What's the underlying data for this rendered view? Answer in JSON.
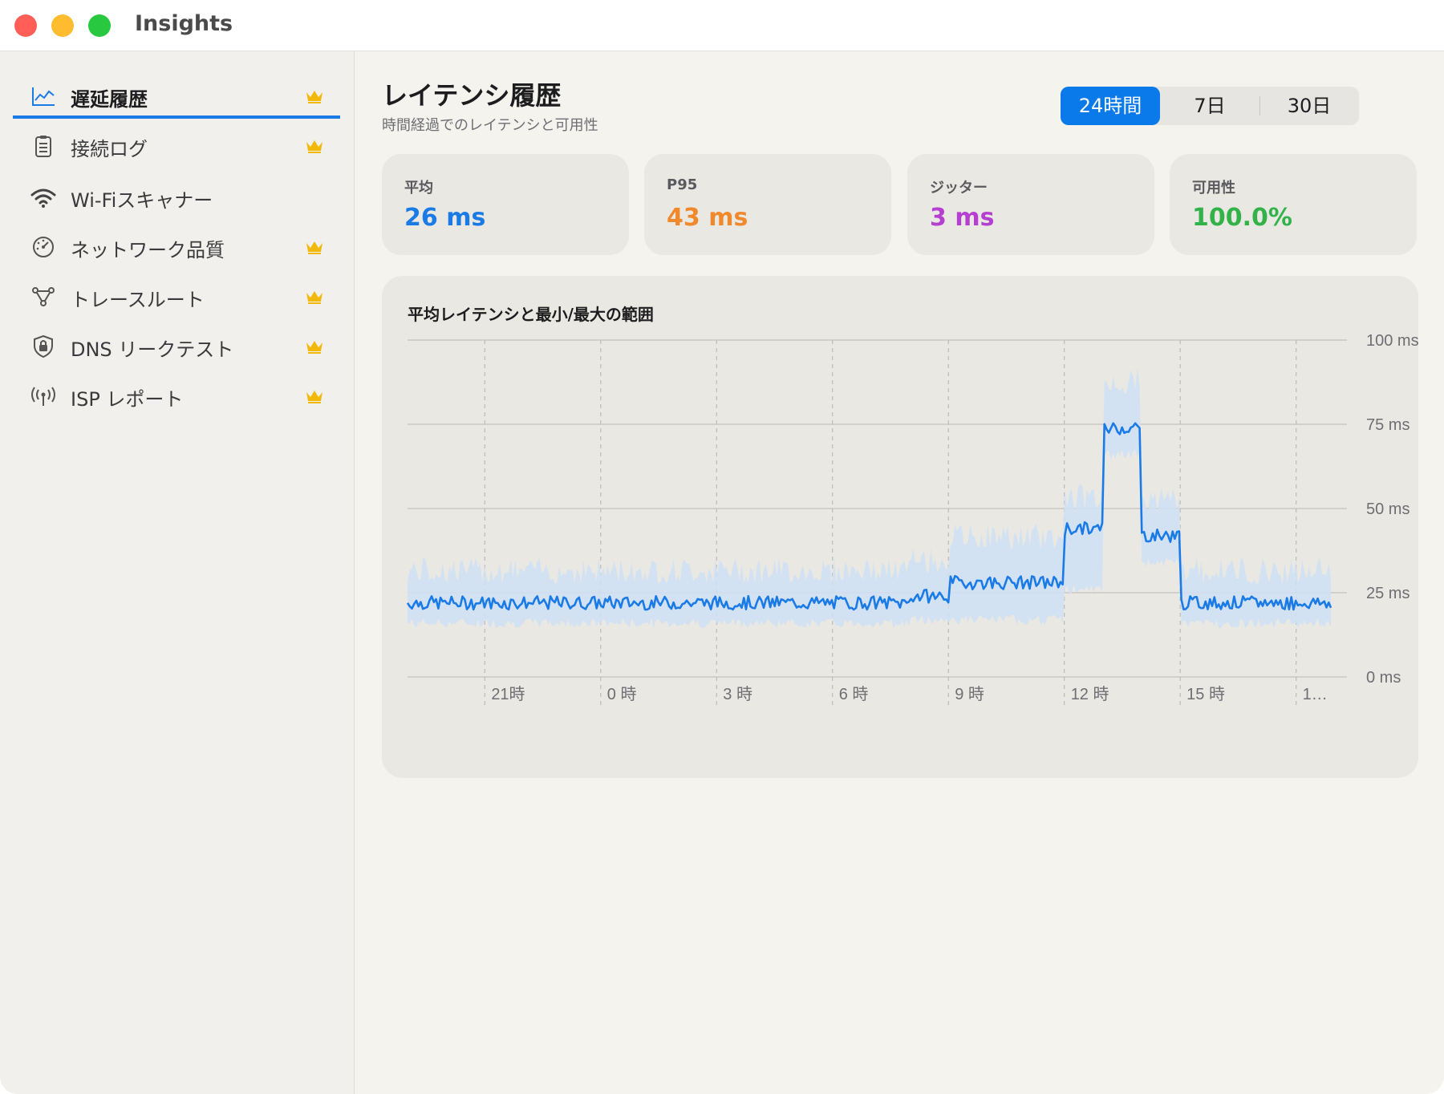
{
  "window": {
    "title": "Insights"
  },
  "sidebar": {
    "items": [
      {
        "label": "遅延履歴",
        "icon": "line-chart-icon",
        "premium": true,
        "active": true
      },
      {
        "label": "接続ログ",
        "icon": "clipboard-icon",
        "premium": true,
        "active": false
      },
      {
        "label": "Wi-Fiスキャナー",
        "icon": "wifi-icon",
        "premium": false,
        "active": false
      },
      {
        "label": "ネットワーク品質",
        "icon": "gauge-icon",
        "premium": true,
        "active": false
      },
      {
        "label": "トレースルート",
        "icon": "route-nodes-icon",
        "premium": true,
        "active": false
      },
      {
        "label": "DNS リークテスト",
        "icon": "shield-lock-icon",
        "premium": true,
        "active": false
      },
      {
        "label": "ISP レポート",
        "icon": "antenna-icon",
        "premium": true,
        "active": false
      }
    ]
  },
  "header": {
    "title": "レイテンシ履歴",
    "subtitle": "時間経過でのレイテンシと可用性"
  },
  "range": {
    "options": [
      "24時間",
      "7日",
      "30日"
    ],
    "selected": "24時間"
  },
  "stats": [
    {
      "label": "平均",
      "value": "26 ms",
      "color": "#1a7ae6"
    },
    {
      "label": "P95",
      "value": "43 ms",
      "color": "#f0892b"
    },
    {
      "label": "ジッター",
      "value": "3 ms",
      "color": "#b43fd0"
    },
    {
      "label": "可用性",
      "value": "100.0%",
      "color": "#34b24a"
    }
  ],
  "chart": {
    "title": "平均レイテンシと最小/最大の範囲"
  },
  "chart_data": {
    "type": "area",
    "title": "平均レイテンシと最小/最大の範囲",
    "xlabel": "",
    "ylabel": "",
    "ylim": [
      0,
      100
    ],
    "yticks": [
      "100 ms",
      "75 ms",
      "50 ms",
      "25 ms",
      "0 ms"
    ],
    "xticks": [
      "21時",
      "0 時",
      "3 時",
      "6 時",
      "9 時",
      "12 時",
      "15 時",
      "1…"
    ],
    "x_hours_range": [
      19,
      18.9
    ],
    "grid": true,
    "series_color": "#1a7ae6",
    "band_color": "#cfe0f4",
    "segments": [
      {
        "from_hour": 19.0,
        "to_hour": 32.0,
        "avg": 22,
        "min": 16,
        "max": 30
      },
      {
        "from_hour": 32.0,
        "to_hour": 33.0,
        "avg": 24,
        "min": 17,
        "max": 33
      },
      {
        "from_hour": 33.0,
        "to_hour": 36.0,
        "avg": 28,
        "min": 17,
        "max": 40
      },
      {
        "from_hour": 36.0,
        "to_hour": 37.0,
        "avg": 44,
        "min": 26,
        "max": 52
      },
      {
        "from_hour": 37.0,
        "to_hour": 38.0,
        "avg": 74,
        "min": 66,
        "max": 86
      },
      {
        "from_hour": 38.0,
        "to_hour": 39.0,
        "avg": 42,
        "min": 34,
        "max": 51
      },
      {
        "from_hour": 39.0,
        "to_hour": 42.9,
        "avg": 22,
        "min": 16,
        "max": 30
      }
    ]
  }
}
